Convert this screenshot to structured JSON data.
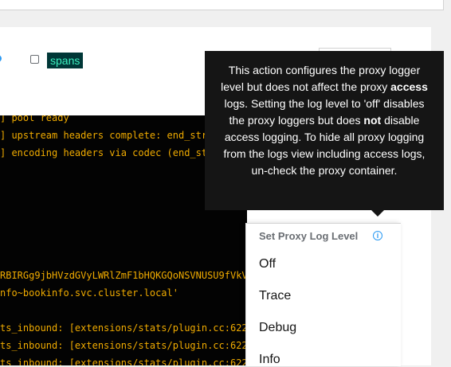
{
  "filters": {
    "spans_label": "spans"
  },
  "logs": {
    "lines": [
      "] pool ready",
      "] upstream headers complete: end_str",
      "] encoding headers via codec (end_st",
      "",
      "",
      "",
      "",
      "",
      "",
      "RBIRGg9jbHVzdGVyLWRlZmF1bHQKGQoNSVNUSU9fVkV",
      "nfo~bookinfo.svc.cluster.local'",
      "",
      "ts_inbound: [extensions/stats/plugin.cc:622",
      "ts_inbound: [extensions/stats/plugin.cc:622",
      "ts_inbound: [extensions/stats/plugin.cc:622"
    ]
  },
  "proxy_menu": {
    "header": "Set Proxy Log Level",
    "info_glyph": "i",
    "items": [
      "Off",
      "Trace",
      "Debug",
      "Info"
    ]
  },
  "tooltip": {
    "part1": "This action configures the proxy logger level but does not affect the proxy ",
    "bold1": "access",
    "part2": " logs. Setting the log level to 'off' disables the proxy loggers but does ",
    "bold2": "not",
    "part3": " disable access logging. To hide all proxy logging from the logs view including access logs, un-check the proxy container."
  },
  "colors": {
    "log_text": "#f0ab00",
    "spans_bg": "#003737",
    "spans_text": "#3cf1c0",
    "info_icon": "#2b9af3"
  }
}
